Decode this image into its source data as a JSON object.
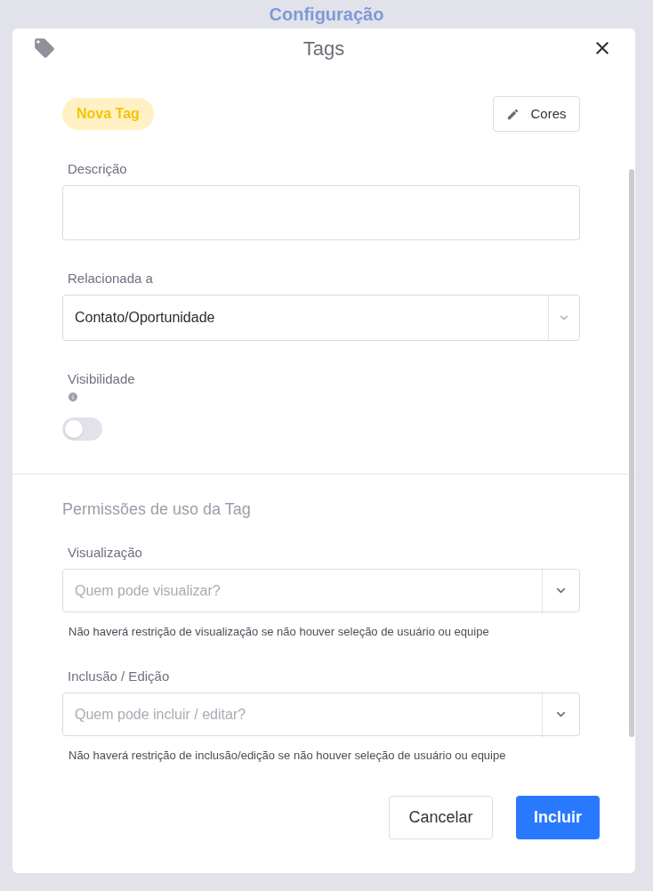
{
  "background": {
    "title": "Configuração"
  },
  "dialog": {
    "title": "Tags",
    "tag_preview": "Nova Tag",
    "colors_button": "Cores",
    "fields": [
      {
        "kind": "textarea",
        "label": "Descrição"
      },
      {
        "kind": "select",
        "label": "Relacionada a",
        "value": "Contato/Oportunidade"
      },
      {
        "kind": "toggle",
        "label": "Visibilidade",
        "on": false
      }
    ],
    "permissions": {
      "title": "Permissões de uso da Tag",
      "fields": [
        {
          "label": "Visualização",
          "placeholder": "Quem pode visualizar?",
          "hint": "Não haverá restrição de visualização se não houver seleção de usuário ou equipe"
        },
        {
          "label": "Inclusão / Edição",
          "placeholder": "Quem pode incluir / editar?",
          "hint": "Não haverá restrição de inclusão/edição se não houver seleção de usuário ou equipe"
        }
      ]
    },
    "buttons": [
      {
        "label": "Cancelar",
        "kind": "secondary"
      },
      {
        "label": "Incluir",
        "kind": "primary"
      }
    ]
  }
}
